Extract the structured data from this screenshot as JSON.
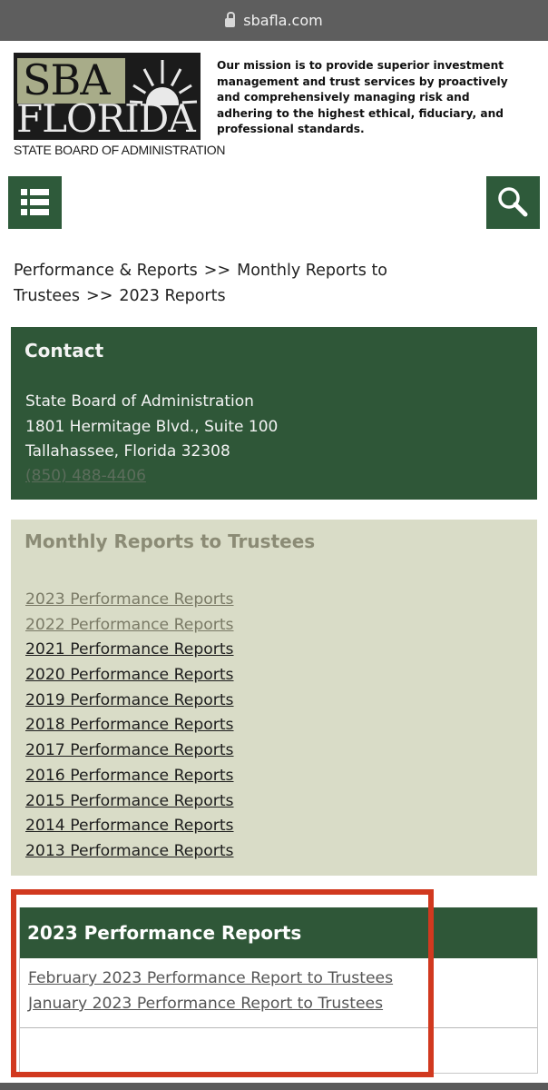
{
  "browser": {
    "url": "sbafla.com"
  },
  "header": {
    "logo": {
      "top": "SBA",
      "middle": "FLORIDA",
      "bottom": "STATE BOARD OF ADMINISTRATION"
    },
    "mission": "Our mission is to provide superior investment management and trust services by proactively and comprehensively managing risk and adhering to the highest ethical, fiduciary, and professional standards."
  },
  "nav": {
    "menu_icon": "menu-icon",
    "search_icon": "search-icon"
  },
  "breadcrumb": {
    "items": [
      "Performance & Reports",
      "Monthly Reports to Trustees",
      "2023 Reports"
    ],
    "separator": ">>"
  },
  "contact": {
    "title": "Contact",
    "lines": [
      "State Board of Administration",
      "1801 Hermitage Blvd., Suite 100",
      "Tallahassee, Florida 32308"
    ],
    "phone": "(850) 488-4406"
  },
  "monthly": {
    "title": "Monthly Reports to Trustees",
    "links": [
      "2023 Performance Reports",
      "2022 Performance Reports",
      "2021 Performance Reports",
      "2020 Performance Reports",
      "2019 Performance Reports",
      "2018 Performance Reports",
      "2017 Performance Reports",
      "2016 Performance Reports",
      "2015 Performance Reports",
      "2014 Performance Reports",
      "2013 Performance Reports"
    ]
  },
  "reports": {
    "title": "2023 Performance Reports",
    "links": [
      "February 2023 Performance Report to Trustees",
      "January 2023 Performance Report to Trustees"
    ]
  },
  "colors": {
    "brand_green": "#2f5738",
    "highlight_red": "#d1391f",
    "panel_beige": "#d9dcc7"
  }
}
